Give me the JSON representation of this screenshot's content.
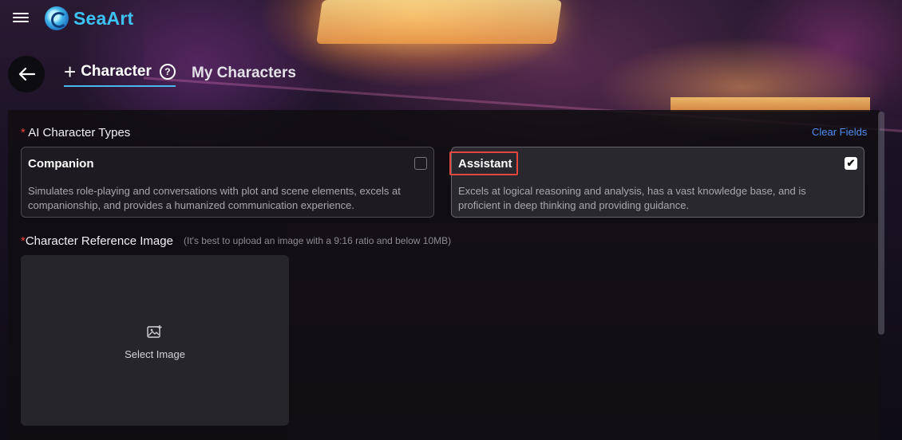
{
  "header": {
    "brand": "SeaArt"
  },
  "tabs": {
    "create_label": "Character",
    "my_characters_label": "My Characters"
  },
  "character_types": {
    "label": "AI Character Types",
    "required_mark": "*",
    "clear_fields": "Clear Fields",
    "options": [
      {
        "title": "Companion",
        "description": "Simulates role-playing and conversations with plot and scene elements, excels at companionship, and provides a humanized communication experience.",
        "checked": false
      },
      {
        "title": "Assistant",
        "description": "Excels at logical reasoning and analysis, has a vast knowledge base, and is proficient in deep thinking and providing guidance.",
        "checked": true
      }
    ]
  },
  "reference_image": {
    "label": "Character Reference Image",
    "required_mark": "*",
    "hint": "(It's best to upload an image with a 9:16 ratio and below 10MB)",
    "upload_label": "Select Image"
  },
  "colors": {
    "accent": "#4ab6ee",
    "link": "#4d8ef5",
    "required": "#e8443c",
    "highlight": "#e4473d"
  }
}
